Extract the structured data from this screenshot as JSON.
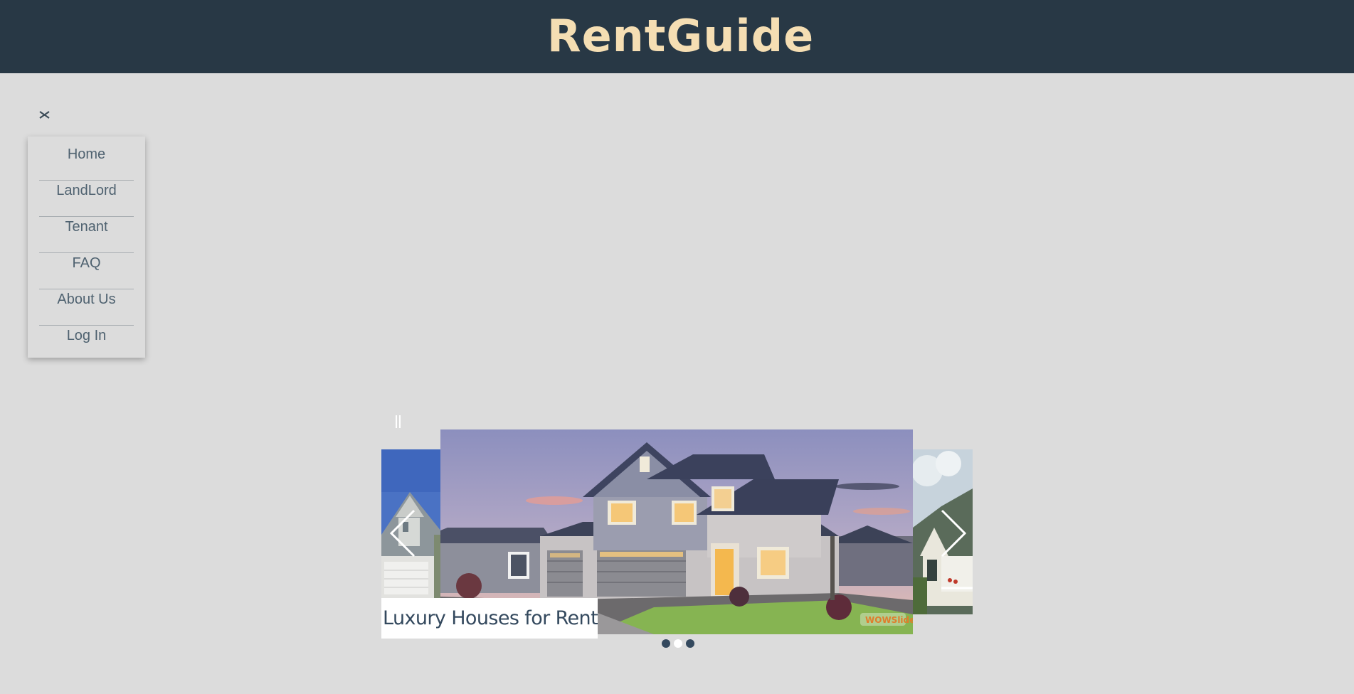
{
  "header": {
    "brand": "RentGuide"
  },
  "menu": {
    "close_icon": "close-icon",
    "items": [
      {
        "label": "Home"
      },
      {
        "label": "LandLord"
      },
      {
        "label": "Tenant"
      },
      {
        "label": "FAQ"
      },
      {
        "label": "About Us"
      },
      {
        "label": "Log In"
      }
    ]
  },
  "slider": {
    "caption": "Luxury Houses for Rent",
    "watermark": "WOWSlider",
    "slide_count": 3,
    "active_slide": 2,
    "pause_icon": "pause-icon",
    "prev_icon": "chevron-left-icon",
    "next_icon": "chevron-right-icon"
  },
  "colors": {
    "header_bg": "#283845",
    "brand_text": "#f5deb3",
    "page_bg": "#dcdcdc",
    "menu_text": "#4f6270",
    "caption_text": "#34495e",
    "dot": "#34495e",
    "dot_active": "#ffffff"
  }
}
